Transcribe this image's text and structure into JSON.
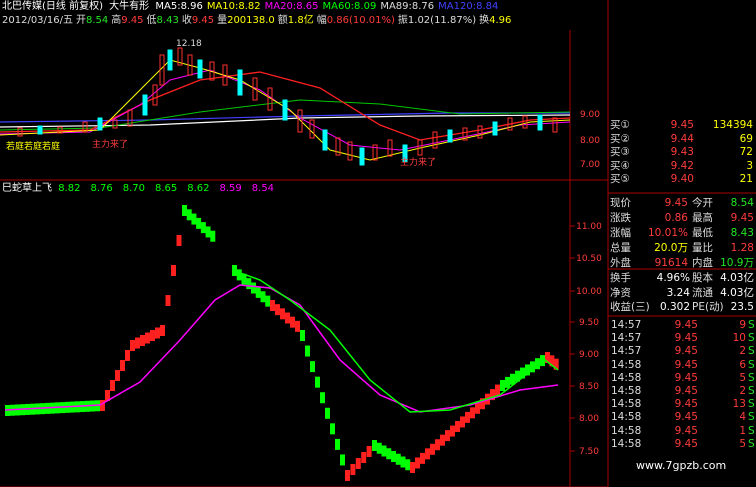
{
  "header": {
    "title": "北巴传媒(日线 前复权)",
    "indicator": "大牛有形",
    "ma": [
      {
        "label": "MA5:",
        "value": "8.96",
        "color": "#ffffff"
      },
      {
        "label": "MA10:",
        "value": "8.82",
        "color": "#ffff00"
      },
      {
        "label": "MA20:",
        "value": "8.65",
        "color": "#ff00ff"
      },
      {
        "label": "MA60:",
        "value": "8.09",
        "color": "#00ff00"
      },
      {
        "label": "MA89:",
        "value": "8.76",
        "color": "#dddddd"
      },
      {
        "label": "MA120:",
        "value": "8.84",
        "color": "#4040ff"
      }
    ]
  },
  "quote_line": {
    "date": "2012/03/16/五",
    "open_label": "开",
    "open": "8.54",
    "high_label": "高",
    "high": "9.45",
    "low_label": "低",
    "low": "8.43",
    "close_label": "收",
    "close": "9.45",
    "vol_label": "量",
    "vol": "200138.0",
    "amt_label": "额",
    "amt": "1.8亿",
    "chg_label": "幅",
    "chg": "0.86(10.01%)",
    "amp_label": "振",
    "amp": "1.02(11.87%)",
    "turn_label": "换",
    "turn": "4.96"
  },
  "main_chart": {
    "peak_label": "12.18",
    "price_axis": [
      "9.00",
      "8.00",
      "7.00"
    ],
    "annotations": [
      {
        "text": "若庭若庭若庭",
        "color": "#ffff00"
      },
      {
        "text": "主力来了",
        "color": "#ff3c3c"
      },
      {
        "text": "主力来了",
        "color": "#ff3c3c"
      }
    ]
  },
  "sub_chart": {
    "name": "巳蛇草上飞",
    "values": [
      {
        "text": "8.82",
        "color": "#00ff00"
      },
      {
        "text": "8.76",
        "color": "#00ff00"
      },
      {
        "text": "8.70",
        "color": "#00ff00"
      },
      {
        "text": "8.65",
        "color": "#00ff00"
      },
      {
        "text": "8.62",
        "color": "#00ff00"
      },
      {
        "text": "8.59",
        "color": "#ff00ff"
      },
      {
        "text": "8.54",
        "color": "#ff00ff"
      }
    ],
    "price_axis": [
      "11.00",
      "10.50",
      "10.00",
      "9.50",
      "9.00",
      "8.50",
      "8.00",
      "7.50"
    ]
  },
  "orderbook": {
    "buys": [
      {
        "label": "买①",
        "price": "9.45",
        "vol": "134394"
      },
      {
        "label": "买②",
        "price": "9.44",
        "vol": "69"
      },
      {
        "label": "买③",
        "price": "9.43",
        "vol": "72"
      },
      {
        "label": "买④",
        "price": "9.42",
        "vol": "3"
      },
      {
        "label": "买⑤",
        "price": "9.40",
        "vol": "21"
      }
    ]
  },
  "stats": [
    {
      "l1": "现价",
      "v1": "9.45",
      "c1": "#ff3c3c",
      "l2": "今开",
      "v2": "8.54",
      "c2": "#22e622"
    },
    {
      "l1": "涨跌",
      "v1": "0.86",
      "c1": "#ff3c3c",
      "l2": "最高",
      "v2": "9.45",
      "c2": "#ff3c3c"
    },
    {
      "l1": "涨幅",
      "v1": "10.01%",
      "c1": "#ff3c3c",
      "l2": "最低",
      "v2": "8.43",
      "c2": "#22e622"
    },
    {
      "l1": "总量",
      "v1": "20.0万",
      "c1": "#ffff00",
      "l2": "量比",
      "v2": "1.28",
      "c2": "#ff3c3c"
    },
    {
      "l1": "外盘",
      "v1": "91614",
      "c1": "#ff3c3c",
      "l2": "内盘",
      "v2": "10.9万",
      "c2": "#22e622"
    }
  ],
  "fund": [
    {
      "l1": "换手",
      "v1": "4.96%",
      "l2": "股本",
      "v2": "4.03亿"
    },
    {
      "l1": "净资",
      "v1": "3.24",
      "l2": "流通",
      "v2": "4.03亿"
    },
    {
      "l1": "收益(三)",
      "v1": "0.302",
      "l2": "PE(动)",
      "v2": "23.5"
    }
  ],
  "ticks": [
    {
      "t": "14:57",
      "p": "9.45",
      "v": "9",
      "s": "S"
    },
    {
      "t": "14:57",
      "p": "9.45",
      "v": "10",
      "s": "S"
    },
    {
      "t": "14:57",
      "p": "9.45",
      "v": "2",
      "s": "S"
    },
    {
      "t": "14:58",
      "p": "9.45",
      "v": "6",
      "s": "S"
    },
    {
      "t": "14:58",
      "p": "9.45",
      "v": "5",
      "s": "S"
    },
    {
      "t": "14:58",
      "p": "9.45",
      "v": "2",
      "s": "S"
    },
    {
      "t": "14:58",
      "p": "9.45",
      "v": "13",
      "s": "S"
    },
    {
      "t": "14:58",
      "p": "9.45",
      "v": "4",
      "s": "S"
    },
    {
      "t": "14:58",
      "p": "9.45",
      "v": "1",
      "s": "S"
    },
    {
      "t": "14:58",
      "p": "9.45",
      "v": "5",
      "s": "S"
    }
  ],
  "watermark": "www.7gpzb.com"
}
